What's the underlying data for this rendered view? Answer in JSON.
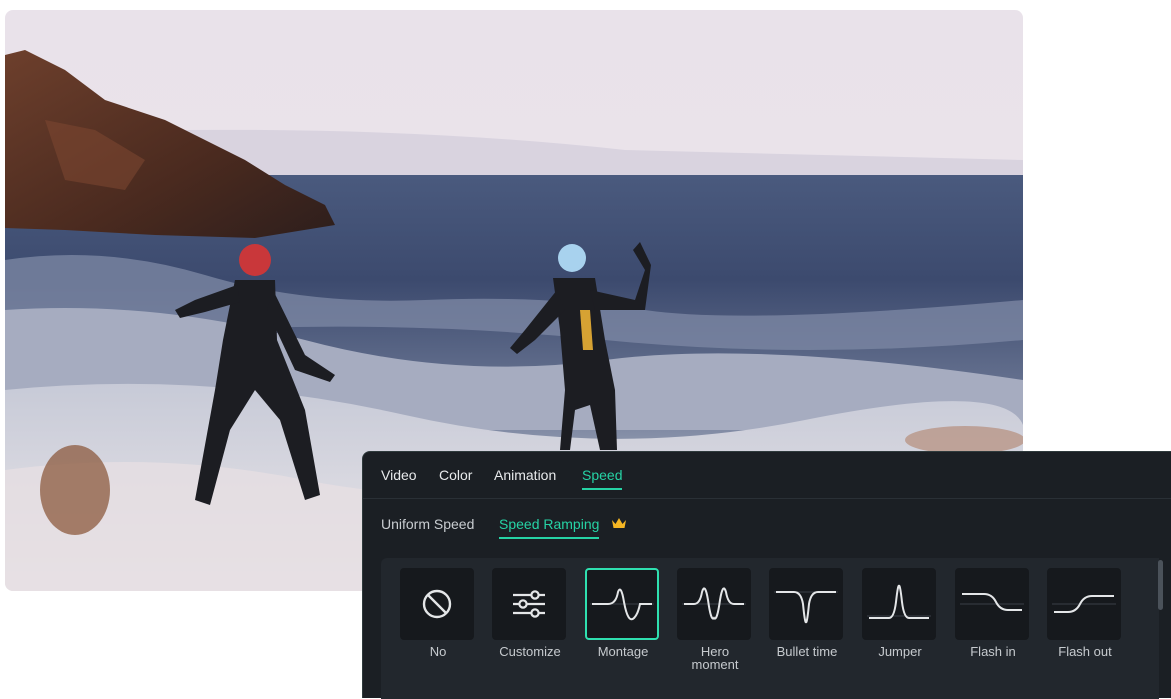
{
  "tabs": [
    {
      "label": "Video"
    },
    {
      "label": "Color"
    },
    {
      "label": "Animation"
    },
    {
      "label": "Speed"
    }
  ],
  "active_tab": "Speed",
  "subtabs": [
    {
      "label": "Uniform Speed"
    },
    {
      "label": "Speed Ramping"
    }
  ],
  "active_subtab": "Speed Ramping",
  "presets": [
    {
      "label": "No",
      "icon": "no-icon"
    },
    {
      "label": "Customize",
      "icon": "sliders-icon"
    },
    {
      "label": "Montage",
      "icon": "montage-curve-icon"
    },
    {
      "label": "Hero\nmoment",
      "icon": "hero-curve-icon"
    },
    {
      "label": "Bullet time",
      "icon": "bullet-time-curve-icon"
    },
    {
      "label": "Jumper",
      "icon": "jumper-curve-icon"
    },
    {
      "label": "Flash in",
      "icon": "flash-in-curve-icon"
    },
    {
      "label": "Flash out",
      "icon": "flash-out-curve-icon"
    }
  ],
  "selected_preset": "Montage",
  "colors": {
    "accent": "#26d3a5",
    "panel_bg": "#1b1f24",
    "crown": "#f5b623"
  }
}
